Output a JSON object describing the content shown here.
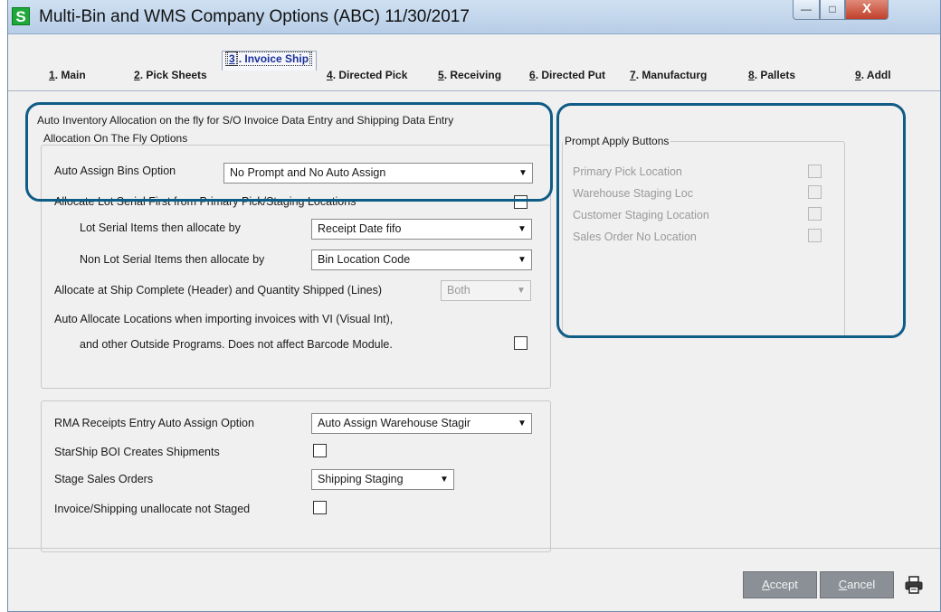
{
  "window": {
    "app_icon_letter": "S",
    "title": "Multi-Bin and WMS Company Options (ABC) 11/30/2017",
    "controls": {
      "minimize": "—",
      "maximize": "□",
      "close": "X"
    }
  },
  "tabs": [
    {
      "num": "1",
      "label": ". Main"
    },
    {
      "num": "2",
      "label": ". Pick Sheets"
    },
    {
      "num": "3",
      "label": ". Invoice Ship"
    },
    {
      "num": "4",
      "label": ". Directed Pick"
    },
    {
      "num": "5",
      "label": ". Receiving"
    },
    {
      "num": "6",
      "label": ". Directed Put"
    },
    {
      "num": "7",
      "label": ". Manufacturg"
    },
    {
      "num": "8",
      "label": ". Pallets"
    },
    {
      "num": "9",
      "label": ". Addl"
    }
  ],
  "active_tab": "3",
  "section": {
    "heading": "Auto Inventory Allocation on the fly for S/O Invoice Data Entry and Shipping Data Entry",
    "group_title": "Allocation On The Fly Options",
    "auto_assign_label": "Auto Assign Bins Option",
    "auto_assign_value": "No Prompt and No Auto Assign",
    "allocate_lot_label": "Allocate Lot Serial First from Primary Pick/Staging Locations",
    "allocate_lot_checked": false,
    "lot_serial_label": "Lot Serial Items then allocate by",
    "lot_serial_value": "Receipt Date fifo",
    "non_lot_label": "Non Lot Serial Items then allocate by",
    "non_lot_value": "Bin Location Code",
    "ship_complete_label": "Allocate at Ship Complete (Header) and Quantity Shipped (Lines)",
    "ship_complete_value": "Both",
    "auto_allocate_line1": "Auto Allocate Locations when importing invoices with VI (Visual Int),",
    "auto_allocate_line2": "and other Outside Programs. Does not affect Barcode Module.",
    "auto_allocate_checked": false
  },
  "lower": {
    "rma_label": "RMA Receipts Entry Auto Assign Option",
    "rma_value": "Auto Assign Warehouse Stagir",
    "starship_label": "StarShip BOI Creates Shipments",
    "starship_checked": false,
    "stage_label": "Stage Sales Orders",
    "stage_value": "Shipping Staging",
    "unallocate_label": "Invoice/Shipping unallocate not Staged",
    "unallocate_checked": false
  },
  "prompt_apply": {
    "title": "Prompt Apply Buttons",
    "items": [
      {
        "label": "Primary Pick Location",
        "checked": false
      },
      {
        "label": "Warehouse Staging Loc",
        "checked": false
      },
      {
        "label": "Customer Staging Location",
        "checked": false
      },
      {
        "label": "Sales Order No Location",
        "checked": false
      }
    ]
  },
  "footer": {
    "accept_underline": "A",
    "accept_rest": "ccept",
    "cancel_underline": "C",
    "cancel_rest": "ancel",
    "print_icon": "printer-icon"
  },
  "colors": {
    "highlight": "#0f5c86",
    "title_gradient_top": "#cfe0f2",
    "button_disabled": "#8a9096"
  }
}
